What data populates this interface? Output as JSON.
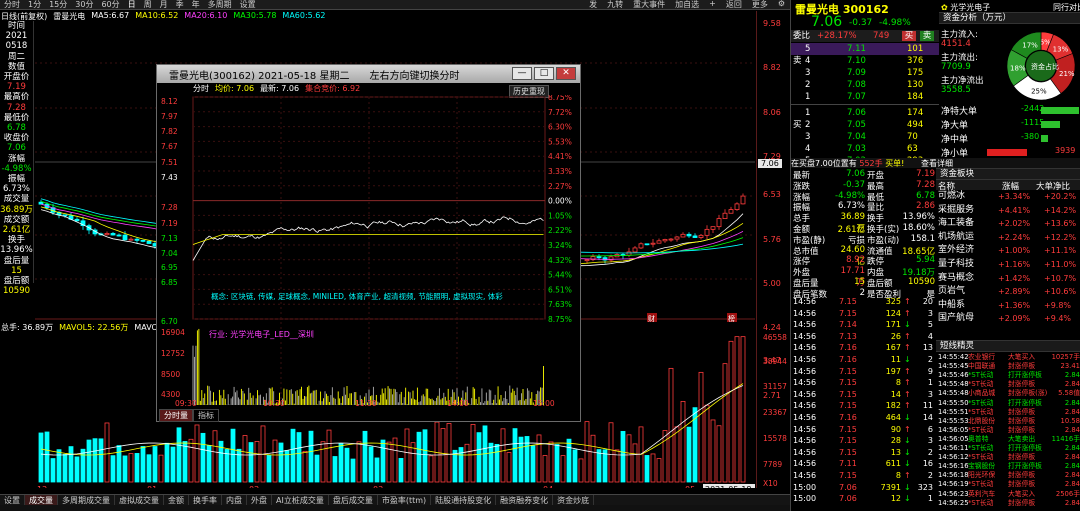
{
  "topbar": {
    "periods": [
      "分时",
      "1分",
      "15分",
      "30分",
      "60分",
      "日",
      "周",
      "月",
      "季",
      "年",
      "多周期",
      "设置"
    ],
    "active_period": "日",
    "right_items": [
      "发",
      "九转",
      "重大事件",
      "加自选",
      "+",
      "返回",
      "更多"
    ],
    "icon_gear": "gear-icon"
  },
  "ma": {
    "title": "日线(前复权)",
    "name": "雷曼光电",
    "items": [
      {
        "label": "MA5:",
        "value": "6.67",
        "color": "#ffffff"
      },
      {
        "label": "MA10:",
        "value": "6.52",
        "color": "#ffff00"
      },
      {
        "label": "MA20:",
        "value": "6.10",
        "color": "#ff40ff"
      },
      {
        "label": "MA30:",
        "value": "5.78",
        "color": "#00ff00"
      },
      {
        "label": "MA60:",
        "value": "5.62",
        "color": "#00ffff"
      }
    ]
  },
  "leftinfo": [
    {
      "t": "时间",
      "c": "white"
    },
    {
      "t": "2021",
      "c": "white"
    },
    {
      "t": "0518",
      "c": "white"
    },
    {
      "t": "周二",
      "c": "white"
    },
    {
      "t": "数值",
      "c": "white"
    },
    {
      "t": "开盘价",
      "c": "white"
    },
    {
      "t": "7.19",
      "c": "red"
    },
    {
      "t": "最高价",
      "c": "white"
    },
    {
      "t": "7.28",
      "c": "red"
    },
    {
      "t": "最低价",
      "c": "white"
    },
    {
      "t": "6.78",
      "c": "green"
    },
    {
      "t": "收盘价",
      "c": "white"
    },
    {
      "t": "7.06",
      "c": "green"
    },
    {
      "t": "涨幅",
      "c": "white"
    },
    {
      "t": "-4.98%",
      "c": "green"
    },
    {
      "t": "振幅",
      "c": "white"
    },
    {
      "t": "6.73%",
      "c": "white"
    },
    {
      "t": "成交量",
      "c": "white"
    },
    {
      "t": "36.89万",
      "c": "yellow"
    },
    {
      "t": "成交额",
      "c": "white"
    },
    {
      "t": "2.61亿",
      "c": "yellow"
    },
    {
      "t": "换手",
      "c": "white"
    },
    {
      "t": "13.96%",
      "c": "white"
    },
    {
      "t": "盘后量",
      "c": "white"
    },
    {
      "t": "15",
      "c": "yellow"
    },
    {
      "t": "盘后额",
      "c": "white"
    },
    {
      "t": "10590",
      "c": "yellow"
    }
  ],
  "price_axis": [
    "9.58",
    "8.82",
    "8.06",
    "7.29",
    "6.53",
    "5.76",
    "5.00",
    "4.24",
    "3.47",
    "2.71"
  ],
  "price_axis_current": "7.06",
  "volume_axis": [
    "46558",
    "38944",
    "31157",
    "23367",
    "15578",
    "7789",
    "X10"
  ],
  "date_axis": [
    "12",
    "01",
    "02",
    "03",
    "04",
    "05"
  ],
  "date_axis_current": "2021-05-18",
  "bottom_marks": [
    "财",
    "榜"
  ],
  "volline": {
    "total": "总手: 36.89万",
    "mavol5": "MAVOL5: 22.56万",
    "mavol10": "MAVOL10: 17.64万"
  },
  "bottom_tabs": [
    "设置",
    "成交量",
    "多周期成交量",
    "虚拟成交量",
    "金额",
    "换手率",
    "内盘",
    "外盘",
    "AI立桩成交量",
    "盘后成交量",
    "市盈率(ttm)",
    "陆股通持股变化",
    "融资融券变化",
    "资金炒底"
  ],
  "bottom_active": "成交量",
  "popup": {
    "title": "雷曼光电(300162) 2021-05-18 星期二",
    "hint": "左右方向键切换分时",
    "header_items": [
      {
        "t": "分时",
        "c": "white"
      },
      {
        "t": "均价: 7.06",
        "c": "yellow"
      },
      {
        "t": "最新: 7.06",
        "c": "white"
      },
      {
        "t": "集合竞价: 6.92",
        "c": "red"
      }
    ],
    "history_btn": "历史重现",
    "left_prices": [
      "8.12",
      "7.97",
      "7.82",
      "7.67",
      "7.51",
      "7.43",
      "7.28",
      "7.19",
      "7.13",
      "7.04",
      "6.95",
      "6.85",
      "6.70"
    ],
    "right_pcts": [
      "8.75%",
      "7.72%",
      "6.30%",
      "5.53%",
      "4.41%",
      "3.33%",
      "2.27%",
      "0.00%",
      "1.05%",
      "2.22%",
      "3.24%",
      "4.32%",
      "5.44%",
      "6.51%",
      "7.63%",
      "8.75%"
    ],
    "vol_axis": [
      "16904",
      "12752",
      "8500",
      "4300"
    ],
    "time_axis": [
      "09:30",
      "10:30",
      "11:30",
      "14:00",
      "15:00"
    ],
    "concept_text": "概念: 区块链, 传媒, 足球概念, MINILED, 体育产业, 超清视频, 节能照明, 虚拟现实, 体彩",
    "industry_text": "行业: 光学光电子_LED__深圳",
    "tabs": [
      "分时量",
      "指标"
    ],
    "active_tab": "分时量",
    "close_icon": "close-icon"
  },
  "stock": {
    "name_code": "雷曼光电 300162",
    "sector_label": "光学光电子",
    "right_top": "同行对比",
    "price": "7.06",
    "change": "-0.37",
    "pct": "-4.98%",
    "entrust_label": "委比",
    "entrust_value": "+28.17%",
    "entrust_diff": "749",
    "buy_label": "买",
    "sell_label": "卖"
  },
  "sells": [
    {
      "lvl": "5",
      "price": "7.11",
      "vol": "101"
    },
    {
      "lvl": "4",
      "price": "7.10",
      "vol": "376"
    },
    {
      "lvl": "3",
      "price": "7.09",
      "vol": "175"
    },
    {
      "lvl": "2",
      "price": "7.08",
      "vol": "130"
    },
    {
      "lvl": "1",
      "price": "7.07",
      "vol": "184"
    }
  ],
  "buys": [
    {
      "lvl": "1",
      "price": "7.06",
      "vol": "174"
    },
    {
      "lvl": "2",
      "price": "7.05",
      "vol": "494"
    },
    {
      "lvl": "3",
      "price": "7.04",
      "vol": "70"
    },
    {
      "lvl": "4",
      "price": "7.03",
      "vol": "63"
    },
    {
      "lvl": "5",
      "price": "7.02",
      "vol": "293"
    }
  ],
  "fund_flow": {
    "title": "资金分析（万元）",
    "in_label": "主力流入:",
    "in_value": "4151.4",
    "out_label": "主力流出:",
    "out_value": "7709.9",
    "net_label": "主力净流出",
    "net_value": "3558.5",
    "donut_center": "资金占比",
    "donut": [
      {
        "label": "6%",
        "value": 6,
        "color": "#ff3c3c"
      },
      {
        "label": "13%",
        "value": 13,
        "color": "#e03030"
      },
      {
        "label": "21%",
        "value": 21,
        "color": "#c02020"
      },
      {
        "label": "25%",
        "value": 25,
        "color": "#ffffff"
      },
      {
        "label": "18%",
        "value": 18,
        "color": "#30a030"
      },
      {
        "label": "17%",
        "value": 17,
        "color": "#1e8a1e"
      }
    ],
    "rows": [
      {
        "label": "净特大单",
        "value": "-2442",
        "bar": 0.62,
        "color": "#2ec12e"
      },
      {
        "label": "净大单",
        "value": "-1115",
        "bar": 0.3,
        "color": "#2ec12e"
      },
      {
        "label": "净中单",
        "value": "-380",
        "bar": 0.12,
        "color": "#2ec12e"
      },
      {
        "label": "净小单",
        "value": "3939",
        "bar": 0.65,
        "color": "#e02020"
      }
    ]
  },
  "notice": {
    "text": "在买盘7.00位置有",
    "vol": "552手",
    "tag": "买单!",
    "link": "查看详细"
  },
  "quote_left": [
    {
      "l": "最新",
      "v": "7.06",
      "c": "green"
    },
    {
      "l": "涨跌",
      "v": "-0.37",
      "c": "green"
    },
    {
      "l": "涨幅",
      "v": "-4.98%",
      "c": "green"
    },
    {
      "l": "振幅",
      "v": "6.73%",
      "c": "white"
    },
    {
      "l": "总手",
      "v": "36.89万",
      "c": "yellow"
    },
    {
      "l": "金额",
      "v": "2.61亿",
      "c": "yellow"
    },
    {
      "l": "市盈(静)",
      "v": "亏损",
      "c": "white"
    },
    {
      "l": "总市值",
      "v": "24.60亿",
      "c": "yellow"
    },
    {
      "l": "涨停",
      "v": "8.92",
      "c": "red"
    },
    {
      "l": "外盘",
      "v": "17.71万",
      "c": "red"
    },
    {
      "l": "盘后量",
      "v": "15",
      "c": "yellow"
    },
    {
      "l": "盘后笔数",
      "v": "2",
      "c": "white"
    }
  ],
  "quote_right": [
    {
      "l": "开盘",
      "v": "7.19",
      "c": "red"
    },
    {
      "l": "最高",
      "v": "7.28",
      "c": "red"
    },
    {
      "l": "最低",
      "v": "6.78",
      "c": "green"
    },
    {
      "l": "量比",
      "v": "2.86",
      "c": "red"
    },
    {
      "l": "换手",
      "v": "13.96%",
      "c": "white"
    },
    {
      "l": "换手(实)",
      "v": "18.60%",
      "c": "white"
    },
    {
      "l": "市盈(动)",
      "v": "158.1",
      "c": "white"
    },
    {
      "l": "流通值",
      "v": "18.65亿",
      "c": "yellow"
    },
    {
      "l": "跌停",
      "v": "5.94",
      "c": "green"
    },
    {
      "l": "内盘",
      "v": "19.18万",
      "c": "green"
    },
    {
      "l": "盘后额",
      "v": "10590",
      "c": "yellow"
    },
    {
      "l": "是否盈利",
      "v": "是",
      "c": "white"
    }
  ],
  "sector": {
    "tab": "资金板块",
    "headers": [
      "名称",
      "涨幅",
      "大单净比"
    ],
    "rows": [
      {
        "n": "可燃冰",
        "p": "+3.34%",
        "b": "+20.2%"
      },
      {
        "n": "采掘服务",
        "p": "+4.41%",
        "b": "+14.2%"
      },
      {
        "n": "海工装备",
        "p": "+2.02%",
        "b": "+13.6%"
      },
      {
        "n": "机场航运",
        "p": "+2.24%",
        "b": "+12.2%"
      },
      {
        "n": "室外经济",
        "p": "+1.00%",
        "b": "+11.1%"
      },
      {
        "n": "量子科技",
        "p": "+1.16%",
        "b": "+11.0%"
      },
      {
        "n": "赛马概念",
        "p": "+1.42%",
        "b": "+10.7%"
      },
      {
        "n": "页岩气",
        "p": "+2.89%",
        "b": "+10.6%"
      },
      {
        "n": "中船系",
        "p": "+1.36%",
        "b": "+9.8%"
      },
      {
        "n": "国产航母",
        "p": "+2.09%",
        "b": "+9.4%"
      }
    ]
  },
  "ticks": [
    {
      "t": "14:56",
      "p": "7.15",
      "v": "325",
      "a": "↑",
      "n": "20"
    },
    {
      "t": "14:56",
      "p": "7.15",
      "v": "124",
      "a": "↑",
      "n": "3"
    },
    {
      "t": "14:56",
      "p": "7.14",
      "v": "171",
      "a": "↓",
      "n": "5"
    },
    {
      "t": "14:56",
      "p": "7.13",
      "v": "26",
      "a": "↑",
      "n": "4"
    },
    {
      "t": "14:56",
      "p": "7.16",
      "v": "167",
      "a": "↑",
      "n": "13"
    },
    {
      "t": "14:56",
      "p": "7.16",
      "v": "11",
      "a": "↓",
      "n": "2"
    },
    {
      "t": "14:56",
      "p": "7.15",
      "v": "197",
      "a": "↑",
      "n": "9"
    },
    {
      "t": "14:56",
      "p": "7.15",
      "v": "8",
      "a": "↑",
      "n": "1"
    },
    {
      "t": "14:56",
      "p": "7.15",
      "v": "14",
      "a": "↑",
      "n": "3"
    },
    {
      "t": "14:56",
      "p": "7.15",
      "v": "182",
      "a": "↑",
      "n": "11"
    },
    {
      "t": "14:56",
      "p": "7.16",
      "v": "464",
      "a": "↓",
      "n": "14"
    },
    {
      "t": "14:56",
      "p": "7.15",
      "v": "90",
      "a": "↑",
      "n": "6"
    },
    {
      "t": "14:56",
      "p": "7.15",
      "v": "28",
      "a": "↓",
      "n": "3"
    },
    {
      "t": "14:56",
      "p": "7.15",
      "v": "13",
      "a": "↓",
      "n": "2"
    },
    {
      "t": "14:56",
      "p": "7.11",
      "v": "611",
      "a": "↓",
      "n": "16"
    },
    {
      "t": "14:56",
      "p": "7.15",
      "v": "8",
      "a": "↑",
      "n": "2"
    },
    {
      "t": "15:00",
      "p": "7.06",
      "v": "7391",
      "a": "↓",
      "n": "323"
    },
    {
      "t": "15:00",
      "p": "7.06",
      "v": "12",
      "a": "↓",
      "n": "1"
    }
  ],
  "elf": {
    "title": "短线精灵",
    "rows": [
      {
        "t": "14:55:42",
        "n": "农业银行",
        "e": "大笔买入",
        "v": "10257手",
        "c": "red"
      },
      {
        "t": "14:55:45",
        "n": "中国联通",
        "e": "封涨停板",
        "v": "23.41",
        "c": "red"
      },
      {
        "t": "14:55:46",
        "n": "*ST长动",
        "e": "打开涨停板",
        "v": "2.84",
        "c": "green"
      },
      {
        "t": "14:55:48",
        "n": "*ST长动",
        "e": "封涨停板",
        "v": "2.84",
        "c": "red"
      },
      {
        "t": "14:55:48",
        "n": "小商品城",
        "e": "封涨停板(涨)",
        "v": "5.58值",
        "c": "red"
      },
      {
        "t": "14:55:50",
        "n": "*ST长动",
        "e": "打开涨停板",
        "v": "2.84",
        "c": "green"
      },
      {
        "t": "14:55:51",
        "n": "*ST长动",
        "e": "封涨停板",
        "v": "2.84",
        "c": "red"
      },
      {
        "t": "14:55:53",
        "n": "北鼎股份",
        "e": "封涨停板",
        "v": "10.58",
        "c": "red"
      },
      {
        "t": "14:56:05",
        "n": "*ST长动",
        "e": "封涨停板",
        "v": "2.84",
        "c": "red"
      },
      {
        "t": "14:56:05",
        "n": "奥普特",
        "e": "大笔卖出",
        "v": "11416手",
        "c": "green"
      },
      {
        "t": "14:56:11",
        "n": "*ST长动",
        "e": "打开涨停板",
        "v": "2.84",
        "c": "green"
      },
      {
        "t": "14:56:12",
        "n": "*ST长动",
        "e": "封涨停板",
        "v": "2.84",
        "c": "red"
      },
      {
        "t": "14:56:16",
        "n": "宝钢股份",
        "e": "打开涨停板",
        "v": "2.84",
        "c": "green"
      },
      {
        "t": "14:56:18",
        "n": "阳光环保",
        "e": "封涨停板",
        "v": "2.84",
        "c": "red"
      },
      {
        "t": "14:56:19",
        "n": "*ST长动",
        "e": "封涨停板",
        "v": "2.84",
        "c": "red"
      },
      {
        "t": "14:56:23",
        "n": "英利汽车",
        "e": "大笔买入",
        "v": "2506手",
        "c": "red"
      },
      {
        "t": "14:56:25",
        "n": "*ST长动",
        "e": "封涨停板",
        "v": "2.84",
        "c": "red"
      }
    ]
  }
}
